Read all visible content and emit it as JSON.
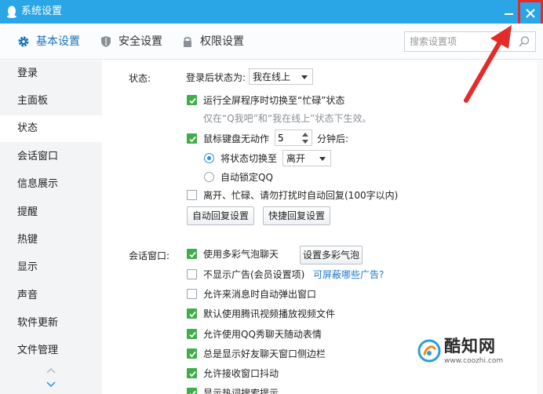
{
  "window": {
    "title": "系统设置"
  },
  "colors": {
    "titlebar": "#2aa6e6",
    "accent": "#1d72b8",
    "checkbox_on": "#3fae49",
    "highlight": "#e52a2a",
    "link": "#1d78c9"
  },
  "topnav": {
    "tabs": [
      {
        "label": "基本设置",
        "icon": "gear-icon",
        "active": true
      },
      {
        "label": "安全设置",
        "icon": "shield-icon",
        "active": false
      },
      {
        "label": "权限设置",
        "icon": "lock-icon",
        "active": false
      }
    ],
    "search_placeholder": "搜索设置项"
  },
  "sidebar": {
    "items": [
      {
        "label": "登录",
        "active": false
      },
      {
        "label": "主面板",
        "active": false
      },
      {
        "label": "状态",
        "active": true
      },
      {
        "label": "会话窗口",
        "active": false
      },
      {
        "label": "信息展示",
        "active": false
      },
      {
        "label": "提醒",
        "active": false
      },
      {
        "label": "热键",
        "active": false
      },
      {
        "label": "显示",
        "active": false
      },
      {
        "label": "声音",
        "active": false
      },
      {
        "label": "软件更新",
        "active": false
      },
      {
        "label": "文件管理",
        "active": false
      }
    ]
  },
  "status_section": {
    "label": "状态:",
    "login_status_label": "登录后状态为:",
    "login_status_value": "我在线上",
    "fullscreen_busy": {
      "label": "运行全屏程序时切换至“忙碌”状态",
      "checked": true
    },
    "fullscreen_hint": "仅在“Q我吧”和“我在线上”状态下生效。",
    "idle": {
      "label_before": "鼠标键盘无动作",
      "minutes": "5",
      "label_after": "分钟后:",
      "checked": true
    },
    "switch_to": {
      "label": "将状态切换至",
      "value": "离开",
      "selected": true
    },
    "auto_lock": {
      "label": "自动锁定QQ",
      "selected": false
    },
    "auto_reply": {
      "label": "离开、忙碌、请勿打扰时自动回复(100字以内)",
      "checked": false
    },
    "auto_reply_button": "自动回复设置",
    "quick_reply_button": "快捷回复设置"
  },
  "chat_section": {
    "label": "会话窗口:",
    "options": [
      {
        "label": "使用多彩气泡聊天",
        "checked": true
      },
      {
        "label": "不显示广告(会员设置项)",
        "checked": false
      },
      {
        "label": "允许来消息时自动弹出窗口",
        "checked": false
      },
      {
        "label": "默认使用腾讯视频播放视频文件",
        "checked": true
      },
      {
        "label": "允许使用QQ秀聊天随动表情",
        "checked": true
      },
      {
        "label": "总是显示好友聊天窗口侧边栏",
        "checked": true
      },
      {
        "label": "允许接收窗口抖动",
        "checked": true
      },
      {
        "label": "显示热词搜索提示",
        "checked": true
      }
    ],
    "bubble_button": "设置多彩气泡",
    "ad_link": "可屏蔽哪些广告?"
  },
  "watermark": {
    "name": "酷知网",
    "url": "www.coozhi.com"
  }
}
